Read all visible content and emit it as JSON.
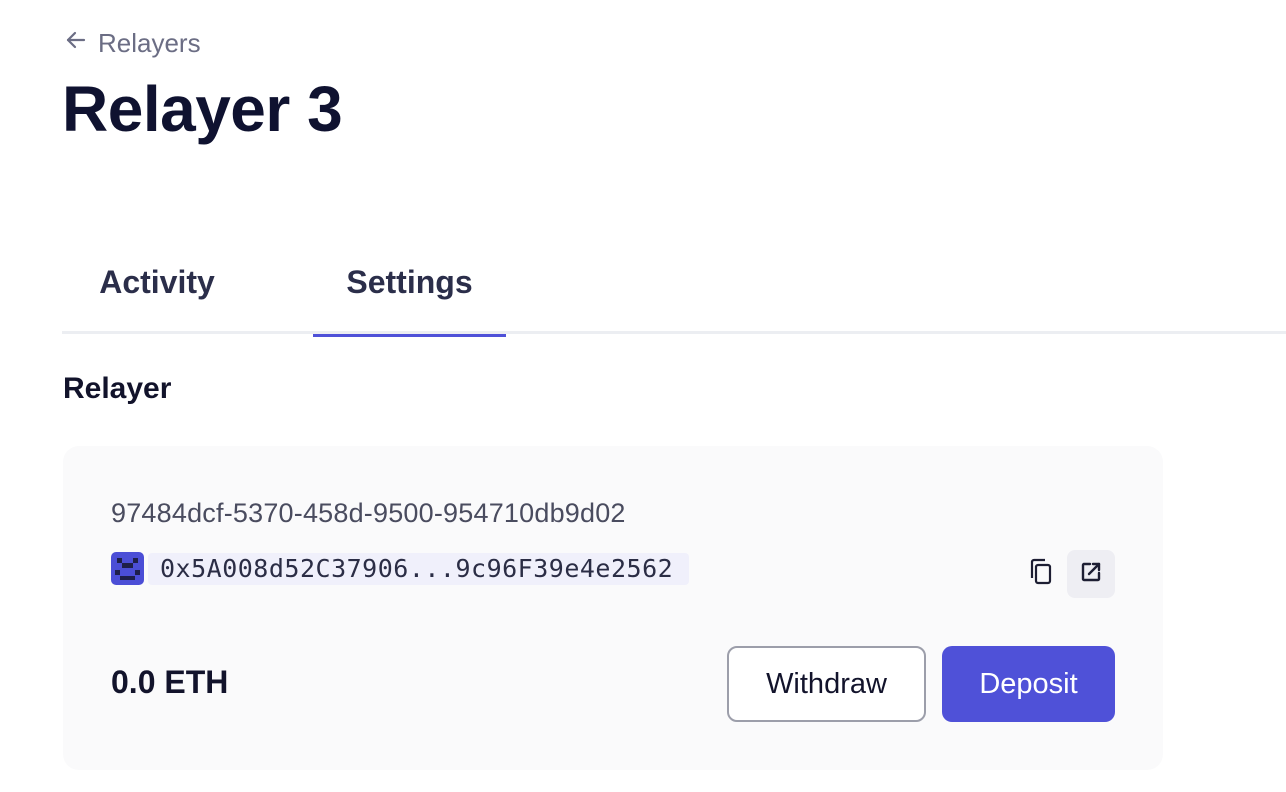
{
  "breadcrumb": {
    "back_label": "Relayers",
    "icon": "arrow-left-icon"
  },
  "page": {
    "title": "Relayer 3"
  },
  "tabs": [
    {
      "label": "Activity",
      "active": false
    },
    {
      "label": "Settings",
      "active": true
    }
  ],
  "section": {
    "title": "Relayer"
  },
  "relayer": {
    "id": "97484dcf-5370-458d-9500-954710db9d02",
    "address": "0x5A008d52C37906...9c96F39e4e2562",
    "balance": "0.0 ETH"
  },
  "actions": {
    "copy_icon": "copy-icon",
    "external_icon": "external-link-icon",
    "withdraw_label": "Withdraw",
    "deposit_label": "Deposit"
  },
  "colors": {
    "accent": "#4f51d8",
    "title": "#0f1230",
    "muted": "#6b6d84",
    "card_bg": "#fafafb"
  }
}
